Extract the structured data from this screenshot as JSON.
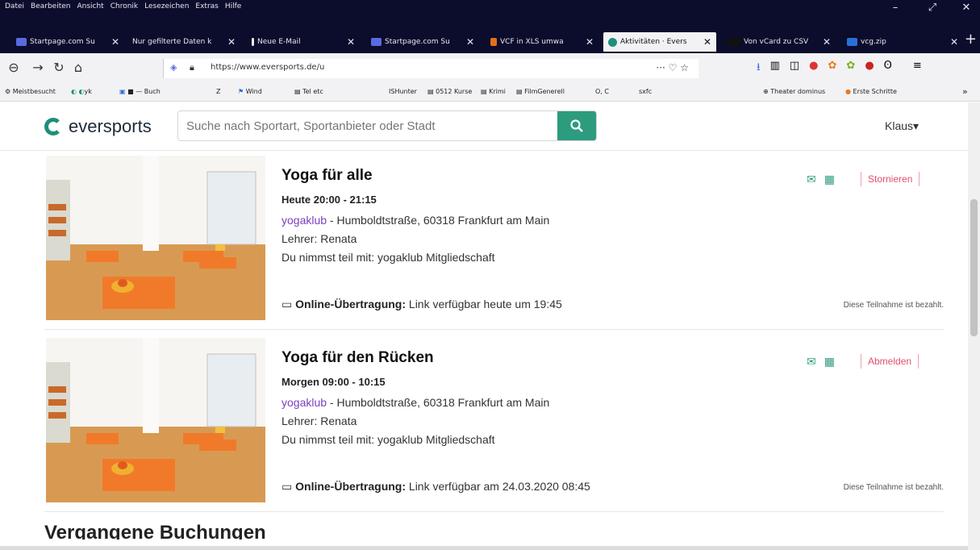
{
  "menubar": {
    "items": [
      "Datei",
      "Bearbeiten",
      "Ansicht",
      "Chronik",
      "Lesezeichen",
      "Extras",
      "Hilfe"
    ]
  },
  "tabs": [
    {
      "title": "Startpage.com Su",
      "active": false,
      "color": "#5a6be0"
    },
    {
      "title": "Nur gefilterte Daten k",
      "active": false,
      "color": "#888888"
    },
    {
      "title": "Neue E-Mail",
      "active": false,
      "color": "#222222"
    },
    {
      "title": "Startpage.com Su",
      "active": false,
      "color": "#5a6be0"
    },
    {
      "title": "VCF in XLS umwa",
      "active": false,
      "color": "#e0701a"
    },
    {
      "title": "Aktivitäten · Evers",
      "active": true,
      "color": "#1e8f7a"
    },
    {
      "title": "Von vCard zu CSV",
      "active": false,
      "color": "#111111"
    },
    {
      "title": "vcg.zip",
      "active": false,
      "color": "#2a6fd6"
    }
  ],
  "navbar": {
    "url": "https://www.eversports.de/u",
    "page_actions": "··· ♡ ☆"
  },
  "bookmarks": [
    "Meistbesucht",
    "yk",
    "Buch",
    "Z",
    "Wind",
    "Tel etc",
    "ISHunter",
    "0512 Kurse",
    "Krimi",
    "FilmGenerell",
    "O, C",
    "sxfc",
    "Theater dominus",
    "Erste Schritte"
  ],
  "site": {
    "logo_text": "eversports",
    "search_placeholder": "Suche nach Sportart, Sportanbieter oder Stadt",
    "user_label": "Klaus",
    "brand_color": "#2d9b7e"
  },
  "activities": [
    {
      "title": "Yoga für alle",
      "time": "Heute 20:00 - 21:15",
      "venue_link": "yogaklub",
      "address": " - Humboldtstraße, 60318 Frankfurt am Main",
      "teacher": "Lehrer: Renata",
      "membership": "Du nimmst teil mit: yogaklub Mitgliedschaft",
      "action_label": "Stornieren",
      "online_label": "Online-Übertragung:",
      "online_text": " Link verfügbar heute um 19:45",
      "paid_text": "Diese Teilnahme ist bezahlt."
    },
    {
      "title": "Yoga für den Rücken",
      "time": "Morgen 09:00 - 10:15",
      "venue_link": "yogaklub",
      "address": " - Humboldtstraße, 60318 Frankfurt am Main",
      "teacher": "Lehrer: Renata",
      "membership": "Du nimmst teil mit: yogaklub Mitgliedschaft",
      "action_label": "Abmelden",
      "online_label": "Online-Übertragung:",
      "online_text": " Link verfügbar am 24.03.2020 08:45",
      "paid_text": "Diese Teilnahme ist bezahlt."
    }
  ],
  "next_section_title": "Vergangene Buchungen"
}
